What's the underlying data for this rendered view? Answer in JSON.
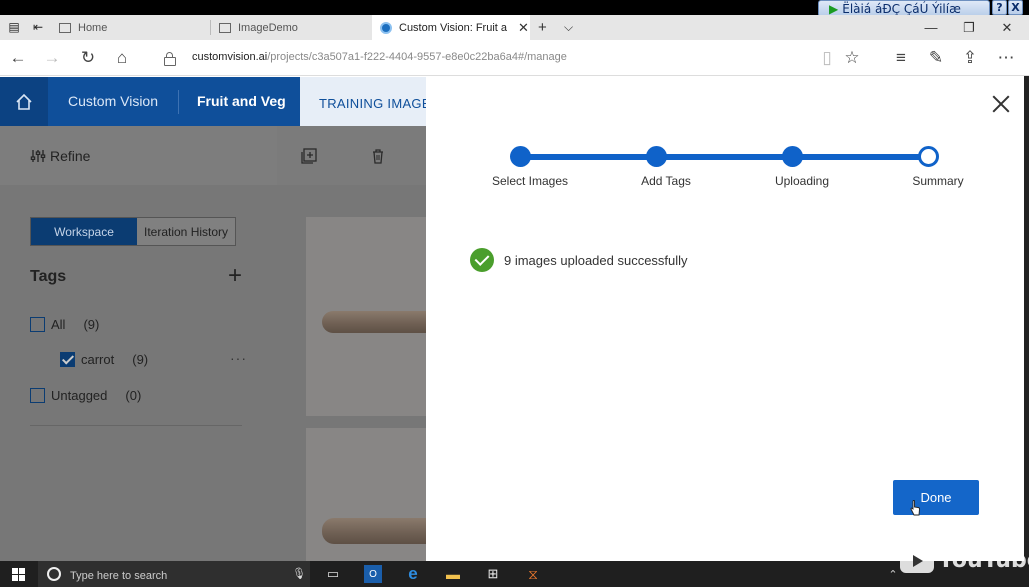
{
  "overlay": {
    "banner_text": "Ëlàiá áÐÇ ÇáÚ Ýilíæ",
    "help": "?",
    "close": "X"
  },
  "browser": {
    "tabs": [
      {
        "label": "Home"
      },
      {
        "label": "ImageDemo"
      },
      {
        "label": "Custom Vision: Fruit and Veg"
      }
    ],
    "new_tab": "+",
    "tab_list": "⌵",
    "window": {
      "minimize": "—",
      "restore": "❐",
      "close": "✕"
    },
    "url_host": "customvision.ai",
    "url_path": "/projects/c3a507a1-f222-4404-9557-e8e0c22ba6a4#/manage"
  },
  "app": {
    "product": "Custom Vision",
    "project": "Fruit and Veg",
    "active_tab": "TRAINING IMAGES"
  },
  "sidebar": {
    "refine_label": "Refine",
    "segments": [
      "Workspace",
      "Iteration History"
    ],
    "tags_title": "Tags",
    "tags": [
      {
        "label": "All",
        "count": "(9)",
        "checked": false
      },
      {
        "label": "carrot",
        "count": "(9)",
        "checked": true
      },
      {
        "label": "Untagged",
        "count": "(0)",
        "checked": false
      }
    ],
    "more": "···"
  },
  "dialog": {
    "steps": [
      "Select Images",
      "Add Tags",
      "Uploading",
      "Summary"
    ],
    "status_text": "9 images uploaded successfully",
    "done_label": "Done",
    "accent": "#1466c9",
    "success_color": "#4a9e2c"
  },
  "taskbar": {
    "search_placeholder": "Type here to search"
  },
  "watermark": {
    "text": "YouTube"
  }
}
